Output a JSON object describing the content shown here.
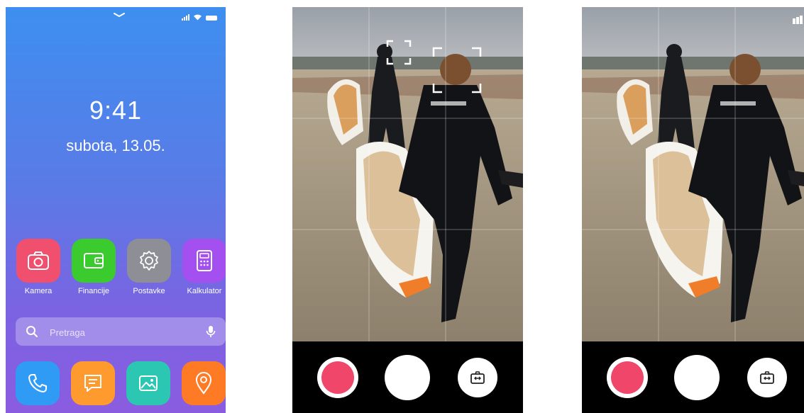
{
  "home": {
    "time": "9:41",
    "date": "subota, 13.05.",
    "apps": [
      {
        "label": "Kamera",
        "icon": "camera-icon",
        "color": "#f0506e"
      },
      {
        "label": "Financije",
        "icon": "wallet-icon",
        "color": "#3ccb2e"
      },
      {
        "label": "Postavke",
        "icon": "gear-icon",
        "color": "#8e8e96"
      },
      {
        "label": "Kalkulator",
        "icon": "calculator-icon",
        "color": "#a44ff0"
      }
    ],
    "search": {
      "placeholder": "Pretraga"
    },
    "dock": [
      {
        "icon": "phone-icon",
        "color": "#2f9bf5"
      },
      {
        "icon": "message-icon",
        "color": "#ff9a2e"
      },
      {
        "icon": "gallery-icon",
        "color": "#2cc7b2"
      },
      {
        "icon": "location-icon",
        "color": "#ff7a24"
      }
    ]
  },
  "camera": {
    "record_color": "#f0466a",
    "screens": [
      "focus-mode",
      "capture-mode"
    ]
  }
}
